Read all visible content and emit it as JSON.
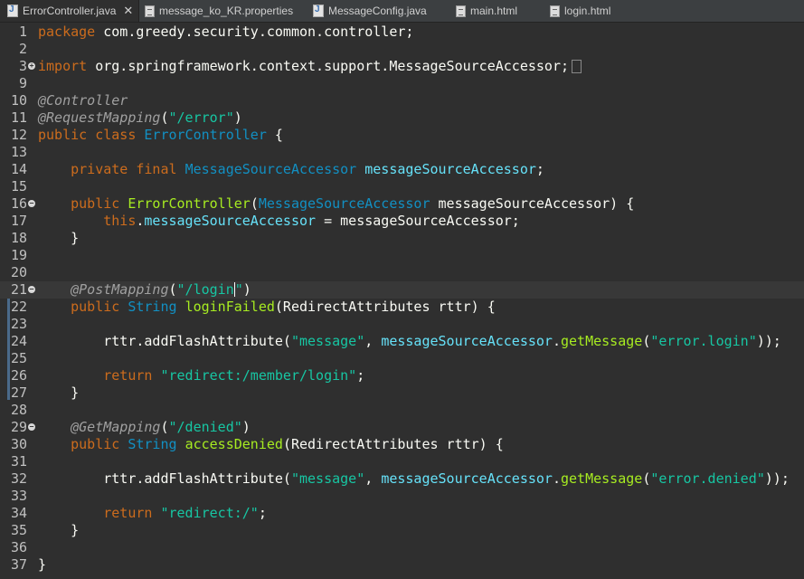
{
  "tabs": [
    {
      "label": "ErrorController.java",
      "icon": "java-icon",
      "active": true
    },
    {
      "label": "message_ko_KR.properties",
      "icon": "document-icon",
      "active": false
    },
    {
      "label": "MessageConfig.java",
      "icon": "java-icon",
      "active": false
    },
    {
      "label": "main.html",
      "icon": "document-icon",
      "active": false
    },
    {
      "label": "login.html",
      "icon": "document-icon",
      "active": false
    }
  ],
  "close_glyph": "✕",
  "lines": [
    {
      "n": "1",
      "tokens": [
        [
          "k",
          "package"
        ],
        [
          "p",
          " com.greedy.security.common.controller;"
        ]
      ]
    },
    {
      "n": "2",
      "tokens": []
    },
    {
      "n": "3",
      "fold": "+",
      "tokens": [
        [
          "k",
          "import"
        ],
        [
          "p",
          " org.springframework.context.support.MessageSourceAccessor;"
        ]
      ],
      "collapsed": true
    },
    {
      "n": "9",
      "tokens": []
    },
    {
      "n": "10",
      "tokens": [
        [
          "a",
          "@Controller"
        ]
      ]
    },
    {
      "n": "11",
      "tokens": [
        [
          "a",
          "@RequestMapping"
        ],
        [
          "p",
          "("
        ],
        [
          "s",
          "\"/error\""
        ],
        [
          "p",
          ")"
        ]
      ]
    },
    {
      "n": "12",
      "tokens": [
        [
          "k",
          "public class "
        ],
        [
          "t",
          "ErrorController"
        ],
        [
          "p",
          " {"
        ]
      ]
    },
    {
      "n": "13",
      "tokens": []
    },
    {
      "n": "14",
      "tokens": [
        [
          "p",
          "    "
        ],
        [
          "k",
          "private final "
        ],
        [
          "t",
          "MessageSourceAccessor"
        ],
        [
          "v",
          " messageSourceAccessor"
        ],
        [
          "p",
          ";"
        ]
      ]
    },
    {
      "n": "15",
      "tokens": []
    },
    {
      "n": "16",
      "fold": "-",
      "tokens": [
        [
          "p",
          "    "
        ],
        [
          "k",
          "public "
        ],
        [
          "m",
          "ErrorController"
        ],
        [
          "p",
          "("
        ],
        [
          "t",
          "MessageSourceAccessor"
        ],
        [
          "p",
          " messageSourceAccessor) {"
        ]
      ]
    },
    {
      "n": "17",
      "tokens": [
        [
          "p",
          "        "
        ],
        [
          "k",
          "this"
        ],
        [
          "p",
          "."
        ],
        [
          "v",
          "messageSourceAccessor"
        ],
        [
          "p",
          " = messageSourceAccessor;"
        ]
      ]
    },
    {
      "n": "18",
      "tokens": [
        [
          "p",
          "    }"
        ]
      ]
    },
    {
      "n": "19",
      "tokens": []
    },
    {
      "n": "20",
      "tokens": []
    },
    {
      "n": "21",
      "fold": "-",
      "current": true,
      "caret_after": 1,
      "tokens": [
        [
          "p",
          "    "
        ],
        [
          "a",
          "@PostMapping"
        ],
        [
          "p",
          "("
        ],
        [
          "s",
          "\"/login"
        ],
        [
          "s",
          "\""
        ],
        [
          "p",
          ")"
        ]
      ]
    },
    {
      "n": "22",
      "tokens": [
        [
          "p",
          "    "
        ],
        [
          "k",
          "public "
        ],
        [
          "t",
          "String"
        ],
        [
          "p",
          " "
        ],
        [
          "m",
          "loginFailed"
        ],
        [
          "p",
          "(RedirectAttributes rttr) {"
        ]
      ]
    },
    {
      "n": "23",
      "tokens": []
    },
    {
      "n": "24",
      "tokens": [
        [
          "p",
          "        rttr.addFlashAttribute("
        ],
        [
          "s",
          "\"message\""
        ],
        [
          "p",
          ", "
        ],
        [
          "v",
          "messageSourceAccessor"
        ],
        [
          "p",
          "."
        ],
        [
          "m",
          "getMessage"
        ],
        [
          "p",
          "("
        ],
        [
          "s",
          "\"error.login\""
        ],
        [
          "p",
          "));"
        ]
      ]
    },
    {
      "n": "25",
      "tokens": []
    },
    {
      "n": "26",
      "tokens": [
        [
          "p",
          "        "
        ],
        [
          "k",
          "return "
        ],
        [
          "s",
          "\"redirect:/member/login\""
        ],
        [
          "p",
          ";"
        ]
      ]
    },
    {
      "n": "27",
      "tokens": [
        [
          "p",
          "    }"
        ]
      ]
    },
    {
      "n": "28",
      "tokens": []
    },
    {
      "n": "29",
      "fold": "-",
      "tokens": [
        [
          "p",
          "    "
        ],
        [
          "a",
          "@GetMapping"
        ],
        [
          "p",
          "("
        ],
        [
          "s",
          "\"/denied\""
        ],
        [
          "p",
          ")"
        ]
      ]
    },
    {
      "n": "30",
      "tokens": [
        [
          "p",
          "    "
        ],
        [
          "k",
          "public "
        ],
        [
          "t",
          "String"
        ],
        [
          "p",
          " "
        ],
        [
          "m",
          "accessDenied"
        ],
        [
          "p",
          "(RedirectAttributes rttr) {"
        ]
      ]
    },
    {
      "n": "31",
      "tokens": []
    },
    {
      "n": "32",
      "tokens": [
        [
          "p",
          "        rttr.addFlashAttribute("
        ],
        [
          "s",
          "\"message\""
        ],
        [
          "p",
          ", "
        ],
        [
          "v",
          "messageSourceAccessor"
        ],
        [
          "p",
          "."
        ],
        [
          "m",
          "getMessage"
        ],
        [
          "p",
          "("
        ],
        [
          "s",
          "\"error.denied\""
        ],
        [
          "p",
          "));"
        ]
      ]
    },
    {
      "n": "33",
      "tokens": []
    },
    {
      "n": "34",
      "tokens": [
        [
          "p",
          "        "
        ],
        [
          "k",
          "return "
        ],
        [
          "s",
          "\"redirect:/\""
        ],
        [
          "p",
          ";"
        ]
      ]
    },
    {
      "n": "35",
      "tokens": [
        [
          "p",
          "    }"
        ]
      ]
    },
    {
      "n": "36",
      "tokens": []
    },
    {
      "n": "37",
      "tokens": [
        [
          "p",
          "}"
        ]
      ]
    }
  ]
}
